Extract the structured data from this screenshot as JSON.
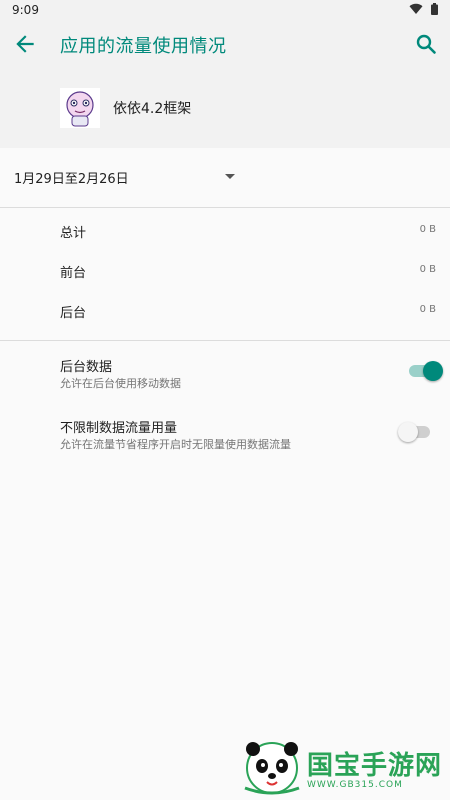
{
  "status_bar": {
    "time": "9:09",
    "icons": [
      "wifi-icon",
      "battery-icon"
    ]
  },
  "app_bar": {
    "title": "应用的流量使用情况",
    "back_icon": "arrow-left-icon",
    "search_icon": "search-icon",
    "accent_color": "#00897b"
  },
  "app_header": {
    "app_name": "依依4.2框架",
    "icon": "app-icon"
  },
  "cycle": {
    "label": "1月29日至2月26日",
    "dropdown_icon": "caret-down-icon"
  },
  "usage": [
    {
      "label": "总计",
      "value": "0 B"
    },
    {
      "label": "前台",
      "value": "0 B"
    },
    {
      "label": "后台",
      "value": "0 B"
    }
  ],
  "settings": [
    {
      "title": "后台数据",
      "subtitle": "允许在后台使用移动数据",
      "enabled": true
    },
    {
      "title": "不限制数据流量用量",
      "subtitle": "允许在流量节省程序开启时无限量使用数据流量",
      "enabled": false
    }
  ],
  "watermark": {
    "title": "国宝手游网",
    "url": "WWW.GB315.COM"
  }
}
